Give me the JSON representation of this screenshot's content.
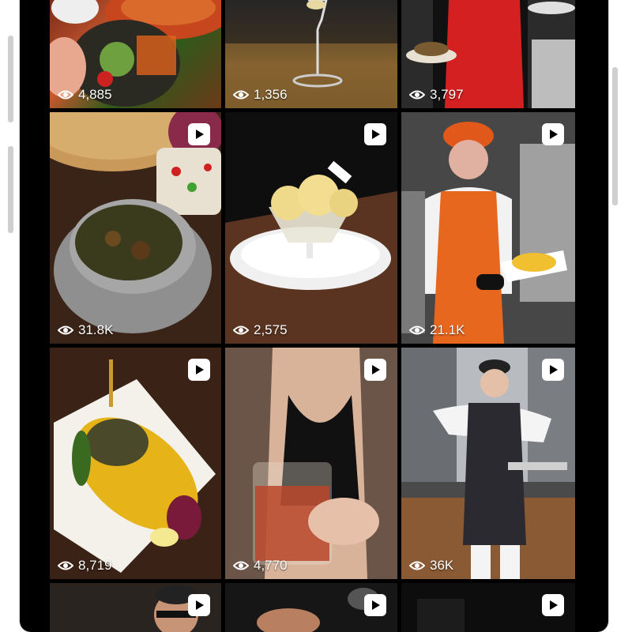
{
  "feed": {
    "posts": [
      {
        "views": "4,885",
        "reel": false,
        "image": "salad-and-soup-photo"
      },
      {
        "views": "1,356",
        "reel": false,
        "image": "wine-glass-photo"
      },
      {
        "views": "3,797",
        "reel": false,
        "image": "chef-red-apron-photo"
      },
      {
        "views": "31.8K",
        "reel": true,
        "image": "stew-bowl-photo"
      },
      {
        "views": "2,575",
        "reel": true,
        "image": "ice-cream-dessert-photo"
      },
      {
        "views": "21.1K",
        "reel": true,
        "image": "chef-orange-apron-photo"
      },
      {
        "views": "8,719",
        "reel": true,
        "image": "saffron-rice-platter-photo"
      },
      {
        "views": "4,770",
        "reel": true,
        "image": "iced-tea-glass-photo"
      },
      {
        "views": "36K",
        "reel": true,
        "image": "chef-street-photo"
      },
      {
        "views": "",
        "reel": true,
        "image": "man-sunglasses-photo"
      },
      {
        "views": "",
        "reel": true,
        "image": "hands-food-photo"
      },
      {
        "views": "",
        "reel": true,
        "image": "dark-scene-photo"
      }
    ]
  },
  "colors": {
    "frame": "#000000",
    "overlay_text": "#ffffff"
  }
}
